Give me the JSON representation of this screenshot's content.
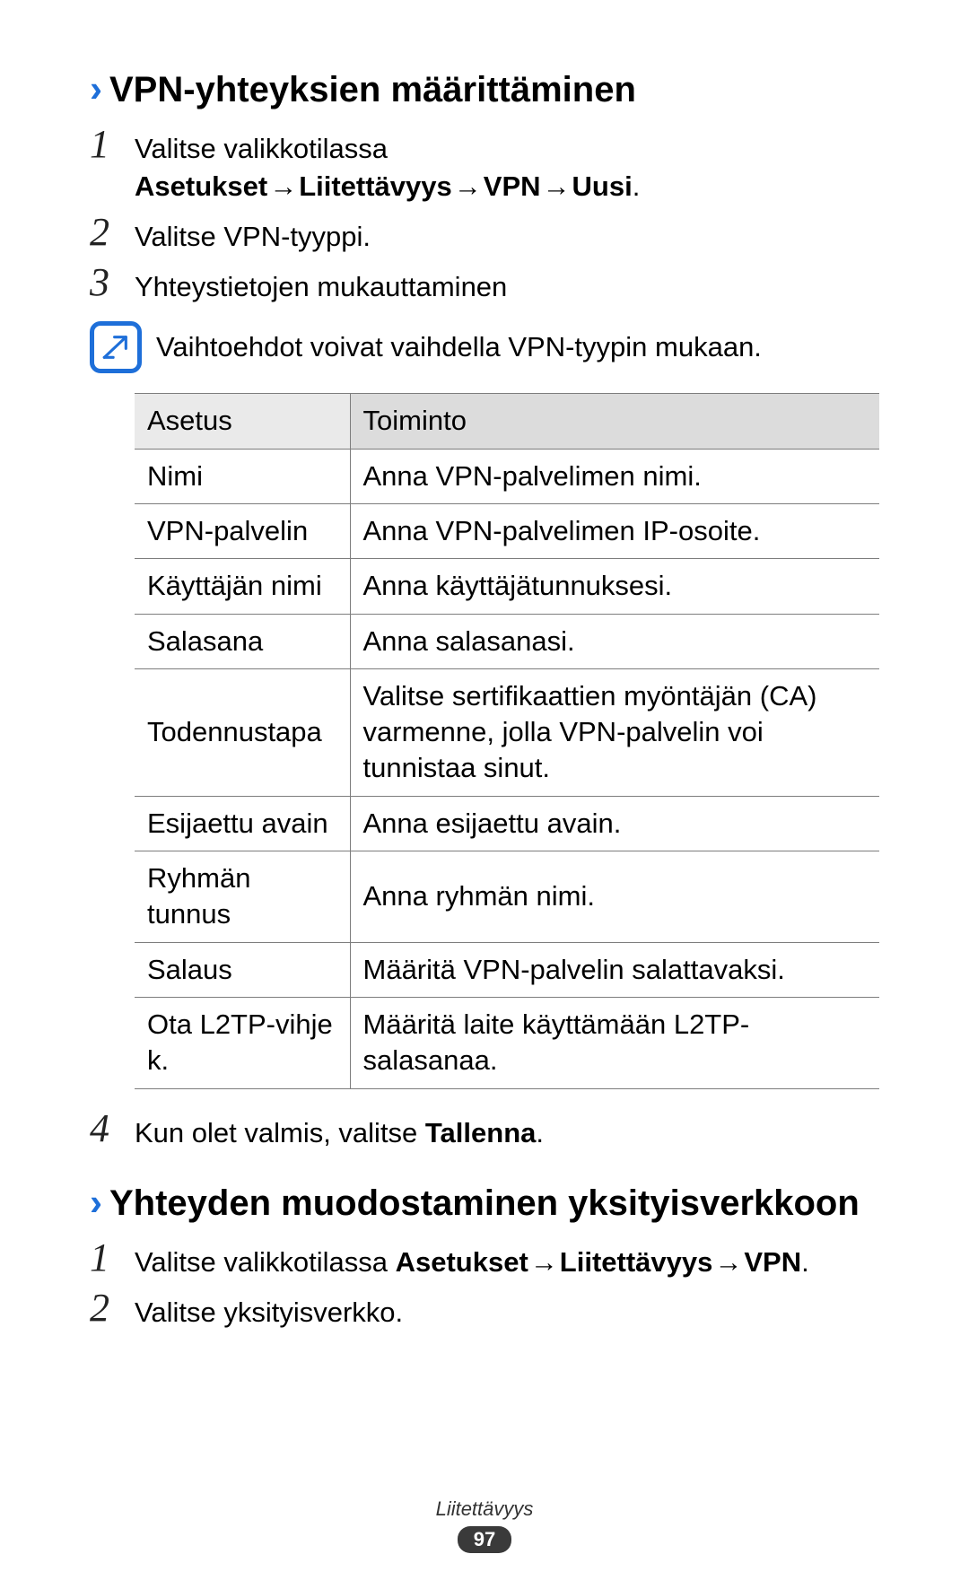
{
  "section1": {
    "heading": "VPN-yhteyksien määrittäminen",
    "step1": {
      "prefix": "Valitse valikkotilassa ",
      "b1": "Asetukset",
      "b2": "Liitettävyys",
      "b3": "VPN",
      "b4": "Uusi",
      "suffix": "."
    },
    "step2": "Valitse VPN-tyyppi.",
    "step3": "Yhteystietojen mukauttaminen",
    "note": "Vaihtoehdot voivat vaihdella VPN-tyypin mukaan.",
    "table": {
      "header": {
        "setting": "Asetus",
        "function": "Toiminto"
      },
      "rows": [
        {
          "setting": "Nimi",
          "function": "Anna VPN-palvelimen nimi."
        },
        {
          "setting": "VPN-palvelin",
          "function": "Anna VPN-palvelimen IP-osoite."
        },
        {
          "setting": "Käyttäjän nimi",
          "function": "Anna käyttäjätunnuksesi."
        },
        {
          "setting": "Salasana",
          "function": "Anna salasanasi."
        },
        {
          "setting": "Todennustapa",
          "function": "Valitse sertifikaattien myöntäjän (CA) varmenne, jolla VPN-palvelin voi tunnistaa sinut."
        },
        {
          "setting": "Esijaettu avain",
          "function": "Anna esijaettu avain."
        },
        {
          "setting": "Ryhmän tunnus",
          "function": "Anna ryhmän nimi."
        },
        {
          "setting": "Salaus",
          "function": "Määritä VPN-palvelin salattavaksi."
        },
        {
          "setting": "Ota L2TP-vihje k.",
          "function": "Määritä laite käyttämään L2TP-salasanaa."
        }
      ]
    },
    "step4": {
      "prefix": "Kun olet valmis, valitse ",
      "b1": "Tallenna",
      "suffix": "."
    }
  },
  "section2": {
    "heading": "Yhteyden muodostaminen yksityisverkkoon",
    "step1": {
      "prefix": "Valitse valikkotilassa ",
      "b1": "Asetukset",
      "b2": "Liitettävyys",
      "b3": "VPN",
      "suffix": "."
    },
    "step2": "Valitse yksityisverkko."
  },
  "arrow": "→",
  "footer": {
    "label": "Liitettävyys",
    "page": "97"
  },
  "nums": {
    "n1": "1",
    "n2": "2",
    "n3": "3",
    "n4": "4"
  }
}
